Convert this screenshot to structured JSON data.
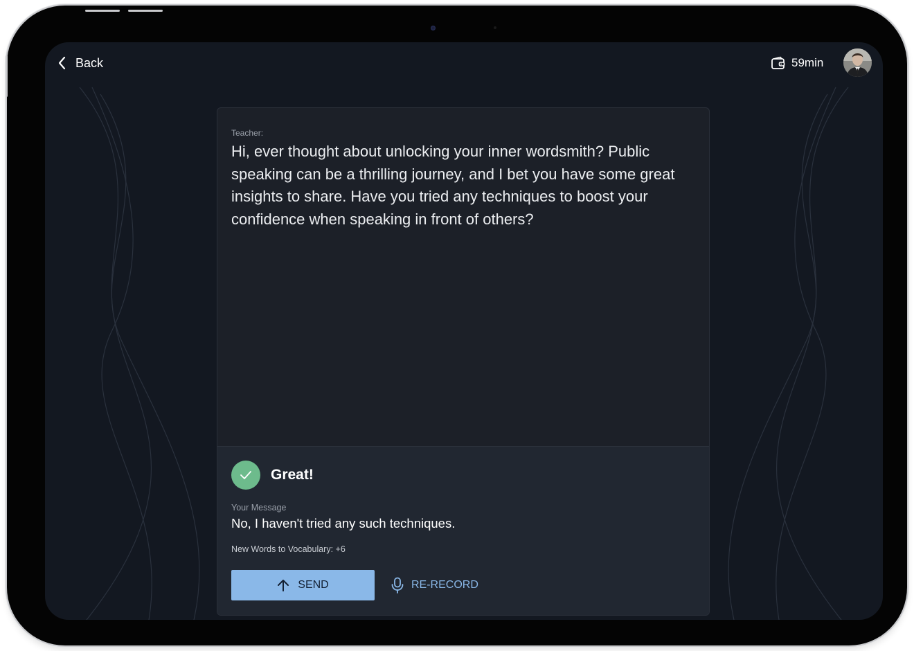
{
  "header": {
    "back_label": "Back",
    "time_remaining": "59min"
  },
  "teacher": {
    "label": "Teacher:",
    "message": "Hi, ever thought about unlocking your inner wordsmith? Public speaking can be a thrilling journey, and I bet you have some great insights to share. Have you tried any techniques to boost your confidence when speaking in front of others?"
  },
  "feedback": {
    "status": "Great!",
    "your_message_label": "Your Message",
    "your_message": "No, I haven't tried any such techniques.",
    "vocabulary_note": "New Words to Vocabulary: +6"
  },
  "actions": {
    "send_label": "SEND",
    "rerecord_label": "RE-RECORD"
  },
  "icons": {
    "back": "chevron-left-icon",
    "time": "wallet-icon",
    "status": "checkmark-icon",
    "send": "arrow-up-icon",
    "rerecord": "microphone-icon"
  },
  "colors": {
    "screen_background": "#131821",
    "card_background": "#1c2028",
    "accent": "#8ab8e8",
    "success": "#6dbb8c"
  }
}
